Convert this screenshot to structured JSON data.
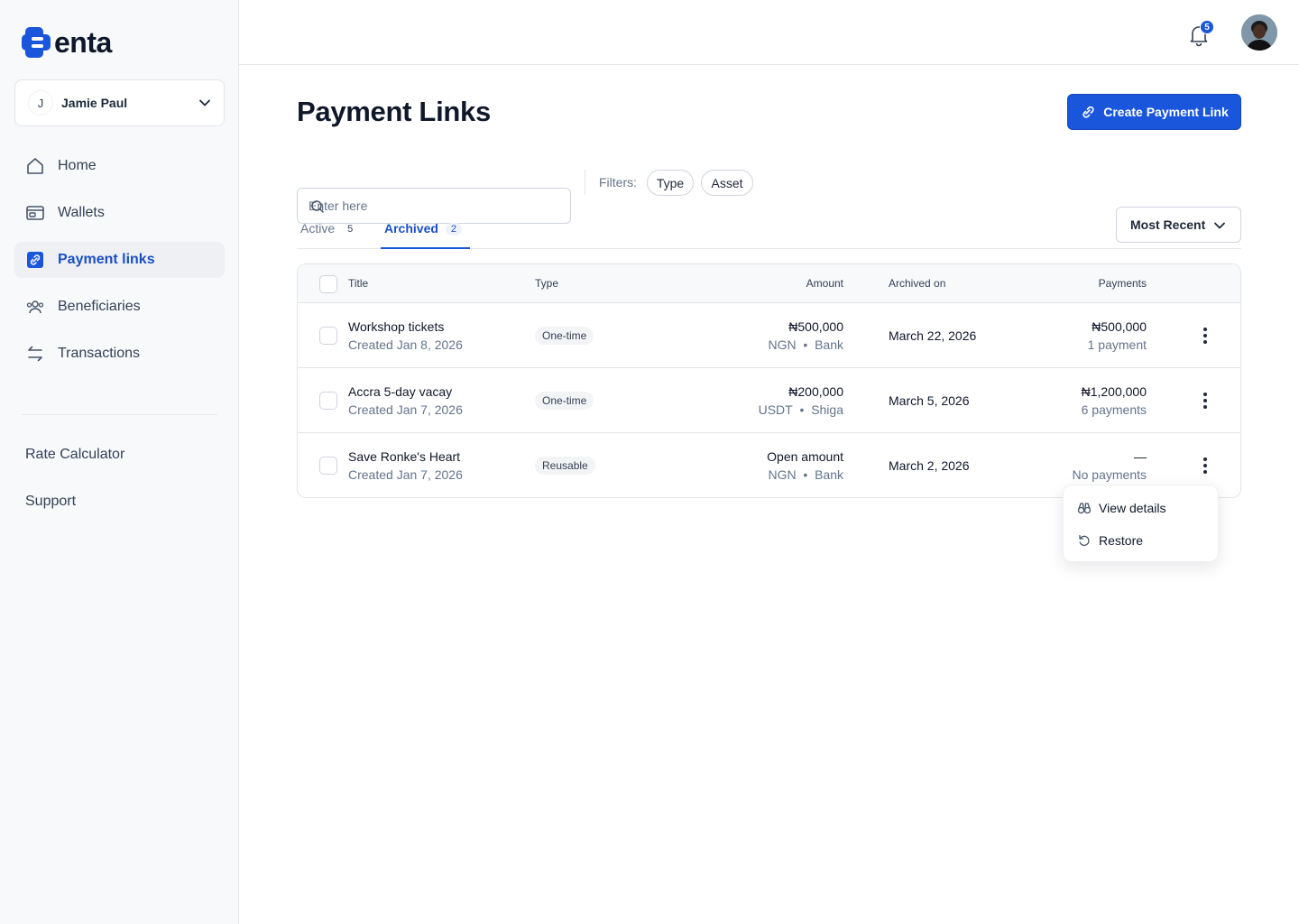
{
  "brand": {
    "name": "enta",
    "accent": "#1a56db"
  },
  "account": {
    "initial": "J",
    "name": "Jamie Paul"
  },
  "nav": {
    "items": [
      {
        "label": "Home",
        "icon": "home-icon"
      },
      {
        "label": "Wallets",
        "icon": "wallet-icon"
      },
      {
        "label": "Payment links",
        "icon": "link-icon",
        "active": true
      },
      {
        "label": "Beneficiaries",
        "icon": "users-icon"
      },
      {
        "label": "Transactions",
        "icon": "transfer-arrows-icon"
      }
    ],
    "secondary": [
      "Rate Calculator",
      "Support"
    ]
  },
  "topbar": {
    "notification_count": "5"
  },
  "page": {
    "title": "Payment Links",
    "create_button": "Create Payment Link",
    "search_placeholder": "Enter here",
    "filters_label": "Filters:",
    "filters": [
      "Type",
      "Asset"
    ],
    "tabs": [
      {
        "label": "Active",
        "count": "5"
      },
      {
        "label": "Archived",
        "count": "2",
        "active": true
      }
    ],
    "sort": "Most Recent"
  },
  "table": {
    "headers": {
      "title": "Title",
      "type": "Type",
      "amount": "Amount",
      "archived_on": "Archived on",
      "payments": "Payments"
    },
    "rows": [
      {
        "title": "Workshop tickets",
        "created": "Created Jan 8, 2026",
        "type": "One-time",
        "amount": "₦500,000",
        "currency": "NGN",
        "channel": "Bank",
        "archived_on": "March 22, 2026",
        "payments_amount": "₦500,000",
        "payments_count": "1 payment"
      },
      {
        "title": "Accra 5-day vacay",
        "created": "Created Jan 7, 2026",
        "type": "One-time",
        "amount": "₦200,000",
        "currency": "USDT",
        "channel": "Shiga",
        "archived_on": "March 5, 2026",
        "payments_amount": "₦1,200,000",
        "payments_count": "6 payments"
      },
      {
        "title": "Save Ronke's Heart",
        "created": "Created Jan 7, 2026",
        "type": "Reusable",
        "amount": "Open amount",
        "currency": "NGN",
        "channel": "Bank",
        "archived_on": "March 2, 2026",
        "payments_amount": "—",
        "payments_count": "No payments"
      }
    ],
    "separator": "•"
  },
  "row_menu": {
    "items": [
      {
        "label": "View details",
        "icon": "binoculars-icon"
      },
      {
        "label": "Restore",
        "icon": "restore-icon"
      }
    ]
  }
}
